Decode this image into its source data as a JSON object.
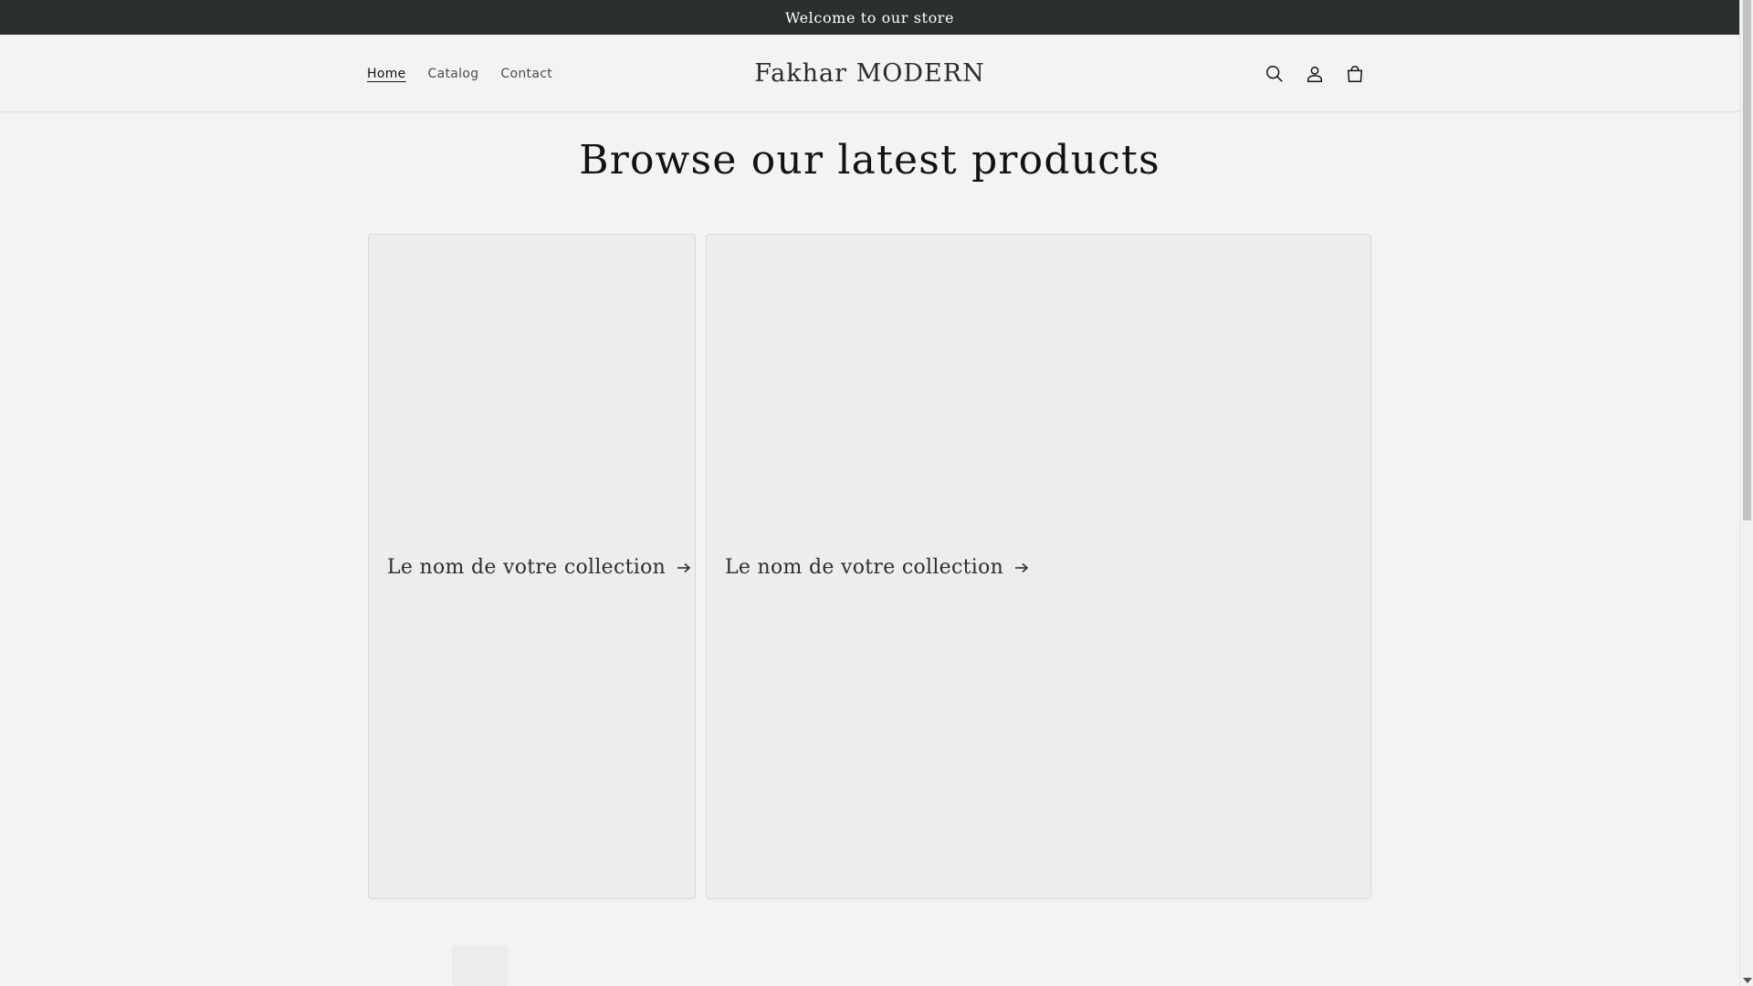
{
  "announcement": {
    "text": "Welcome to our store"
  },
  "header": {
    "nav": [
      {
        "label": "Home",
        "active": true
      },
      {
        "label": "Catalog",
        "active": false
      },
      {
        "label": "Contact",
        "active": false
      }
    ],
    "logo": "Fakhar MODERN",
    "icons": [
      "search-icon",
      "account-icon",
      "cart-icon"
    ]
  },
  "main": {
    "title": "Browse our latest products",
    "collections": [
      {
        "label": "Le nom de votre collection",
        "icon": "arrow-right-icon"
      },
      {
        "label": "Le nom de votre collection",
        "icon": "arrow-right-icon"
      }
    ]
  },
  "colors": {
    "announcement_bg": "#2a3030",
    "page_bg": "#f3f3f3",
    "card_bg": "#eeedeb"
  }
}
